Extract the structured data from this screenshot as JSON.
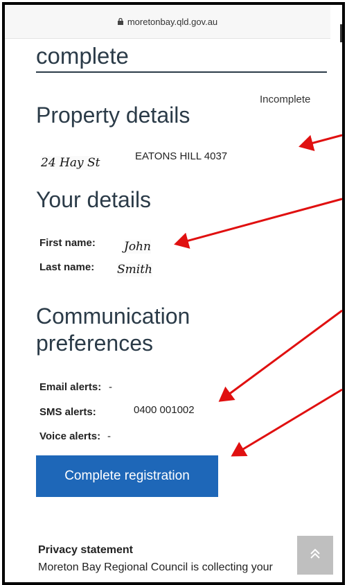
{
  "browser": {
    "url": "moretonbay.qld.gov.au"
  },
  "page": {
    "heading_partial": "complete",
    "status_text": "Incomplete"
  },
  "property": {
    "heading": "Property details",
    "street": "24 Hay St",
    "suburb": "EATONS HILL 4037"
  },
  "your_details": {
    "heading": "Your details",
    "first_name_label": "First name:",
    "first_name_value": "John",
    "last_name_label": "Last name:",
    "last_name_value": "Smith"
  },
  "communication": {
    "heading_line1": "Communication",
    "heading_line2": "preferences",
    "email_label": "Email alerts:",
    "email_value": "-",
    "sms_label": "SMS alerts:",
    "sms_value": "0400 001002",
    "voice_label": "Voice alerts:",
    "voice_value": "-"
  },
  "actions": {
    "complete_registration_label": "Complete registration"
  },
  "privacy": {
    "heading": "Privacy statement",
    "text": "Moreton Bay Regional Council is collecting your"
  },
  "colors": {
    "primary_button": "#1e67b8",
    "heading": "#2b3b48",
    "annotation_arrow": "#e01010"
  },
  "icons": {
    "lock": "lock-icon",
    "scroll_top": "double-chevron-up-icon"
  }
}
